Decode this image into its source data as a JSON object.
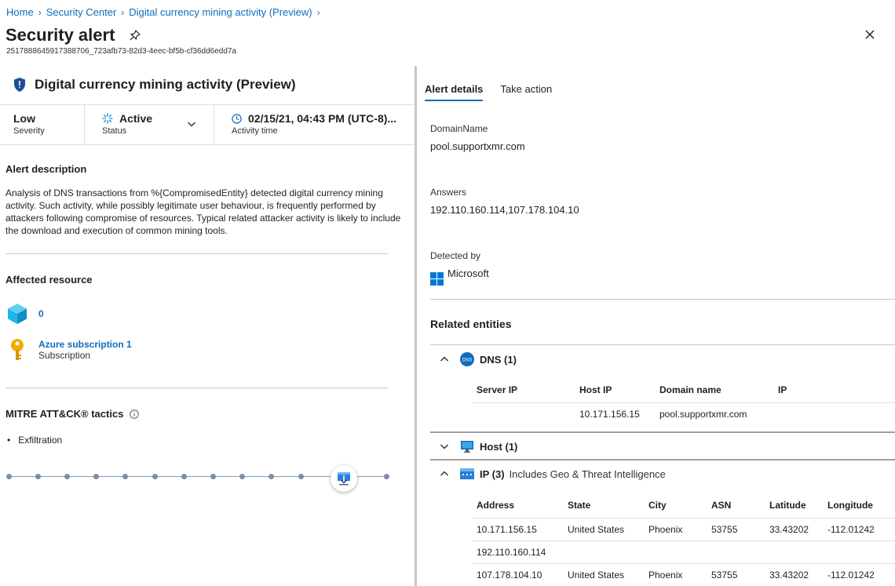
{
  "breadcrumb": {
    "items": [
      "Home",
      "Security Center",
      "Digital currency mining activity (Preview)"
    ]
  },
  "page": {
    "title": "Security alert",
    "alert_id": "2517888645917388706_723afb73-82d3-4eec-bf5b-cf36dd6edd7a"
  },
  "alert": {
    "name": "Digital currency mining activity (Preview)",
    "severity_value": "Low",
    "severity_label": "Severity",
    "status_value": "Active",
    "status_label": "Status",
    "time_value": "02/15/21, 04:43 PM (UTC-8)...",
    "time_label": "Activity time"
  },
  "description": {
    "title": "Alert description",
    "text": "Analysis of DNS transactions from %{CompromisedEntity} detected digital currency mining activity. Such activity, while possibly legitimate user behaviour, is frequently performed by attackers following compromise of resources. Typical related attacker activity is likely to include the download and execution of common mining tools."
  },
  "affected": {
    "title": "Affected resource",
    "resources": [
      {
        "name": "0",
        "subtitle": "",
        "icon": "cube-icon"
      },
      {
        "name": "Azure subscription 1",
        "subtitle": "Subscription",
        "icon": "key-icon"
      }
    ]
  },
  "mitre": {
    "title": "MITRE ATT&CK® tactics",
    "tactics": [
      "Exfiltration"
    ],
    "bullet": "•",
    "timeline_active_index": 11
  },
  "tabs": [
    {
      "label": "Alert details",
      "active": true
    },
    {
      "label": "Take action",
      "active": false
    }
  ],
  "details": {
    "domain_label": "DomainName",
    "domain_value": "pool.supportxmr.com",
    "answers_label": "Answers",
    "answers_value": "192.110.160.114,107.178.104.10",
    "detected_label": "Detected by",
    "detected_value": "Microsoft"
  },
  "related": {
    "title": "Related entities",
    "dns": {
      "label": "DNS (1)",
      "icon_text": "DNS",
      "columns": [
        "Server IP",
        "Host IP",
        "Domain name",
        "IP"
      ],
      "rows": [
        [
          "",
          "10.171.156.15",
          "pool.supportxmr.com",
          ""
        ]
      ]
    },
    "host": {
      "label": "Host (1)"
    },
    "ip": {
      "label": "IP (3)",
      "sublabel": "Includes Geo & Threat Intelligence",
      "columns": [
        "Address",
        "State",
        "City",
        "ASN",
        "Latitude",
        "Longitude"
      ],
      "rows": [
        [
          "10.171.156.15",
          "United States",
          "Phoenix",
          "53755",
          "33.43202",
          "-112.01242"
        ],
        [
          "192.110.160.114",
          "",
          "",
          "",
          "",
          ""
        ],
        [
          "107.178.104.10",
          "United States",
          "Phoenix",
          "53755",
          "33.43202",
          "-112.01242"
        ]
      ]
    }
  },
  "colors": {
    "link": "#0f6cbd",
    "shield": "#1f4e99",
    "cube": "#1fb5e6",
    "key": "#f2a900",
    "dns_badge": "#0f6cbd",
    "ip_icon": "#2b7fd4"
  }
}
